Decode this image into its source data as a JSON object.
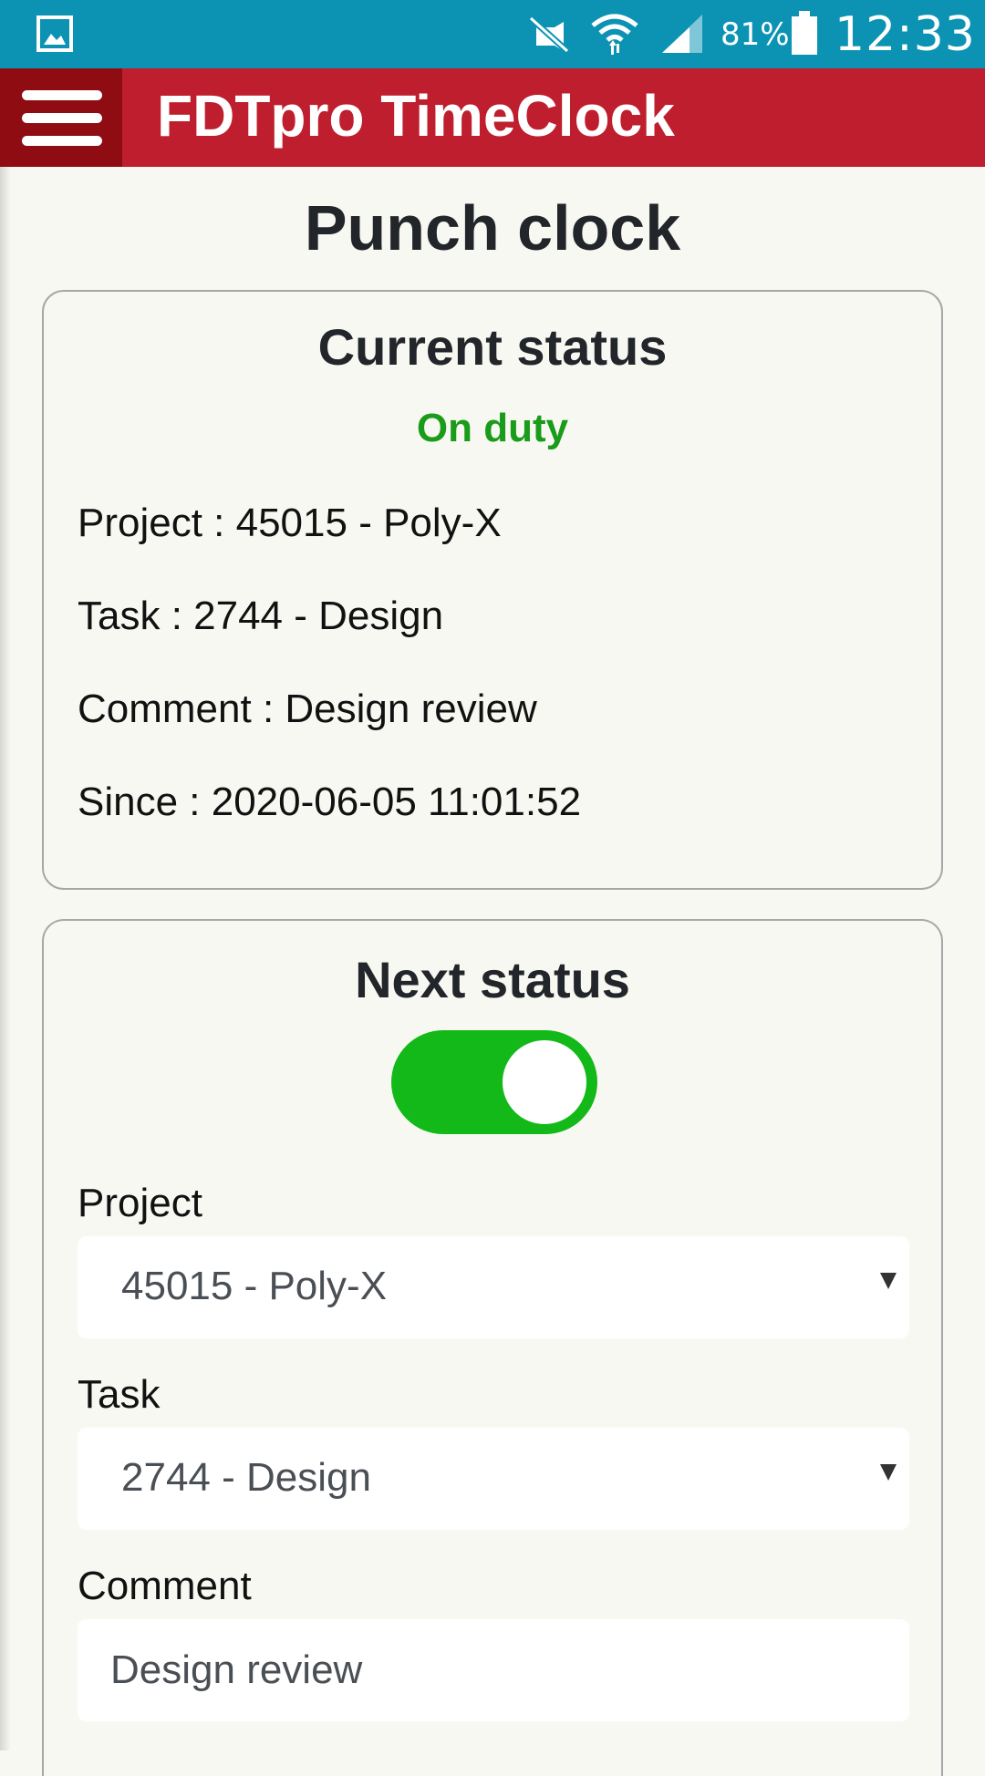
{
  "status_bar": {
    "battery": "81%",
    "time": "12:33",
    "icons": [
      "gallery-icon",
      "mute-icon",
      "wifi-icon",
      "signal-icon",
      "battery-icon"
    ]
  },
  "app_bar": {
    "title": "FDTpro TimeClock",
    "menu_icon": "hamburger-menu-icon"
  },
  "page": {
    "title": "Punch clock"
  },
  "current_status": {
    "title": "Current status",
    "state": "On duty",
    "state_color": "#1a9c1a",
    "project": "Project : 45015 - Poly-X",
    "task": "Task : 2744 - Design",
    "comment": "Comment : Design review",
    "since": "Since : 2020-06-05 11:01:52"
  },
  "next_status": {
    "title": "Next status",
    "toggle_on": true,
    "toggle_color": "#13b919",
    "project_label": "Project",
    "project_value": "45015 - Poly-X",
    "task_label": "Task",
    "task_value": "2744 - Design",
    "comment_label": "Comment",
    "comment_value": "Design review"
  },
  "colors": {
    "status_bar": "#0c93b3",
    "app_bar": "#be1e2d",
    "menu_button": "#8e0c12",
    "background": "#f8f8f3"
  }
}
